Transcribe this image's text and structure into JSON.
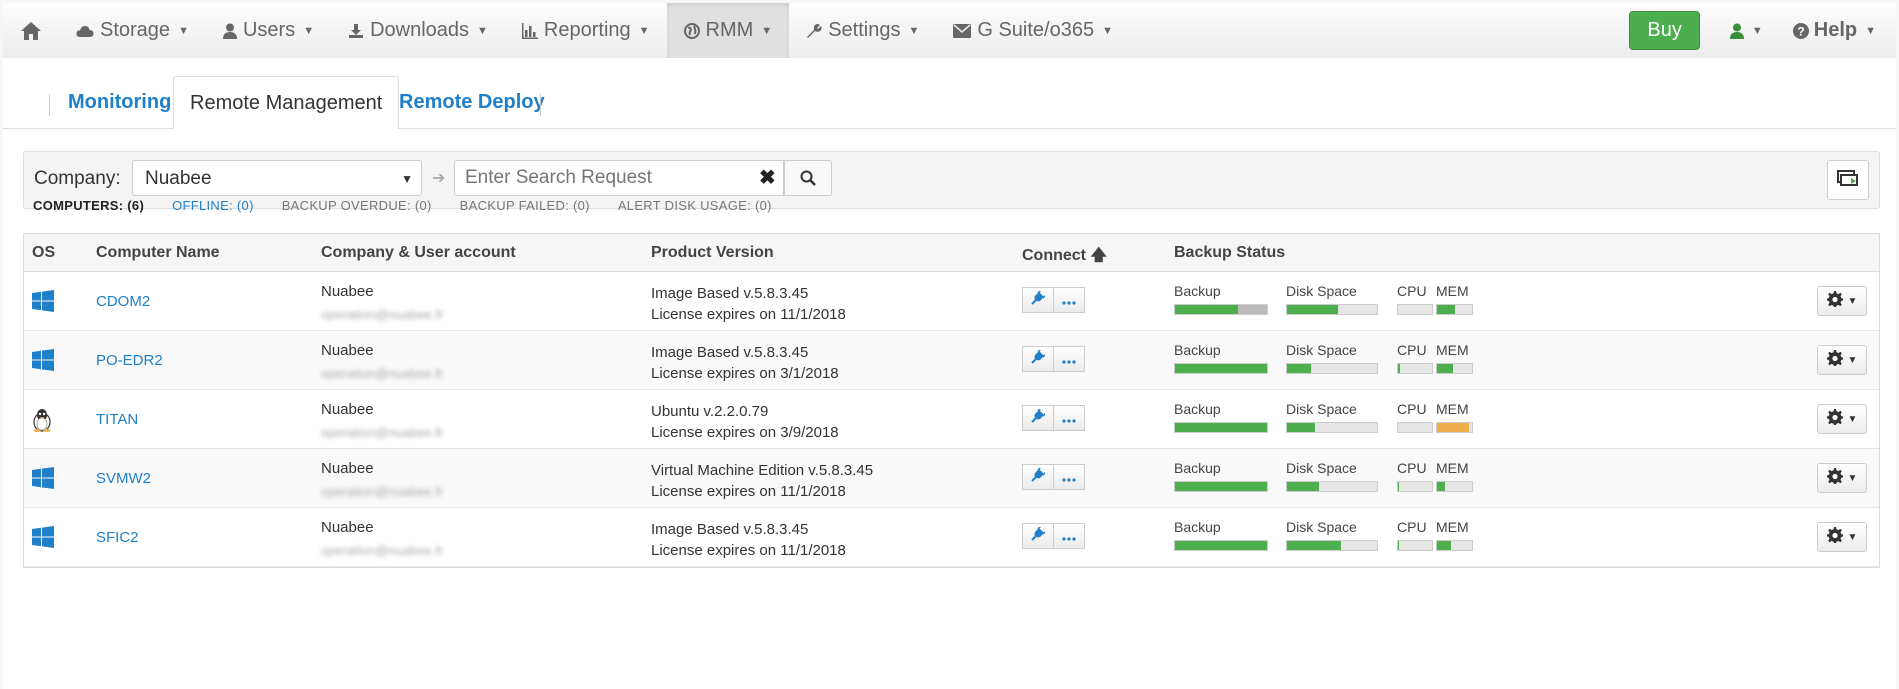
{
  "nav": {
    "items": [
      {
        "label": "Storage",
        "icon": "cloud-icon"
      },
      {
        "label": "Users",
        "icon": "user-icon"
      },
      {
        "label": "Downloads",
        "icon": "download-icon"
      },
      {
        "label": "Reporting",
        "icon": "bar-chart-icon"
      },
      {
        "label": "RMM",
        "icon": "globe-icon"
      },
      {
        "label": "Settings",
        "icon": "wrench-icon"
      },
      {
        "label": "G Suite/o365",
        "icon": "envelope-icon"
      }
    ],
    "active": "RMM",
    "buy_label": "Buy",
    "help_label": "Help"
  },
  "tabs": [
    {
      "label": "Monitoring"
    },
    {
      "label": "Remote Management"
    },
    {
      "label": "Remote Deploy"
    }
  ],
  "toolbar": {
    "company_label": "Company:",
    "company_value": "Nuabee",
    "search_placeholder": "Enter Search Request"
  },
  "filters": [
    {
      "label": "COMPUTERS: (6)"
    },
    {
      "label": "OFFLINE: (0)"
    },
    {
      "label": "BACKUP OVERDUE: (0)"
    },
    {
      "label": "BACKUP FAILED: (0)"
    },
    {
      "label": "ALERT DISK USAGE: (0)"
    }
  ],
  "table": {
    "headers": {
      "os": "OS",
      "name": "Computer Name",
      "company": "Company & User account",
      "product": "Product Version",
      "connect": "Connect",
      "backup": "Backup Status"
    },
    "bar_labels": {
      "backup": "Backup",
      "disk": "Disk Space",
      "cpu": "CPU",
      "mem": "MEM"
    },
    "rows": [
      {
        "os": "windows",
        "name": "CDOM2",
        "company": "Nuabee",
        "account": "operation@nuabee.fr",
        "product": "Image Based v.5.8.3.45",
        "license": "License expires on 11/1/2018",
        "backup_pct": 0.68,
        "backup_grey": true,
        "disk_pct": 0.57,
        "cpu_pct": 0.0,
        "mem_pct": 0.5,
        "mem_color": "#4cae4c"
      },
      {
        "os": "windows",
        "name": "PO-EDR2",
        "company": "Nuabee",
        "account": "operation@nuabee.fr",
        "product": "Image Based v.5.8.3.45",
        "license": "License expires on 3/1/2018",
        "backup_pct": 1.0,
        "backup_grey": false,
        "disk_pct": 0.27,
        "cpu_pct": 0.05,
        "mem_pct": 0.45,
        "mem_color": "#4cae4c"
      },
      {
        "os": "linux",
        "name": "TITAN",
        "company": "Nuabee",
        "account": "operation@nuabee.fr",
        "product": "Ubuntu v.2.2.0.79",
        "license": "License expires on 3/9/2018",
        "backup_pct": 1.0,
        "backup_grey": false,
        "disk_pct": 0.31,
        "cpu_pct": 0.0,
        "mem_pct": 0.92,
        "mem_color": "#f0ad4e"
      },
      {
        "os": "windows",
        "name": "SVMW2",
        "company": "Nuabee",
        "account": "operation@nuabee.fr",
        "product": "Virtual Machine Edition v.5.8.3.45",
        "license": "License expires on 11/1/2018",
        "backup_pct": 1.0,
        "backup_grey": false,
        "disk_pct": 0.35,
        "cpu_pct": 0.03,
        "mem_pct": 0.22,
        "mem_color": "#4cae4c"
      },
      {
        "os": "windows",
        "name": "SFIC2",
        "company": "Nuabee",
        "account": "operation@nuabee.fr",
        "product": "Image Based v.5.8.3.45",
        "license": "License expires on 11/1/2018",
        "backup_pct": 1.0,
        "backup_grey": false,
        "disk_pct": 0.6,
        "cpu_pct": 0.03,
        "mem_pct": 0.4,
        "mem_color": "#4cae4c"
      }
    ]
  }
}
